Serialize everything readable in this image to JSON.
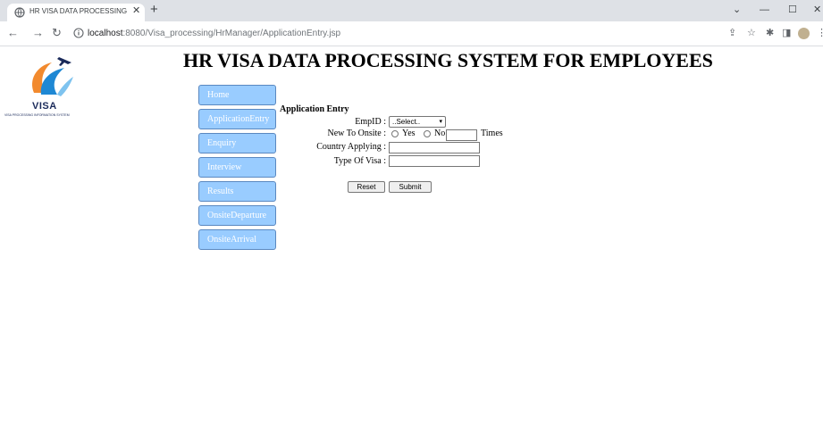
{
  "browser": {
    "tab_title": "HR VISA DATA PROCESSING SYS",
    "url_host": "localhost",
    "url_path": ":8080/Visa_processing/HrManager/ApplicationEntry.jsp"
  },
  "logo": {
    "text": "VISA",
    "subtext": "VISA PROCESSING INFORMATION SYSTEM"
  },
  "page_title": "HR VISA DATA PROCESSING SYSTEM FOR EMPLOYEES",
  "menu": {
    "items": [
      {
        "label": "Home"
      },
      {
        "label": "ApplicationEntry"
      },
      {
        "label": "Enquiry"
      },
      {
        "label": "Interview"
      },
      {
        "label": "Results"
      },
      {
        "label": "OnsiteDeparture"
      },
      {
        "label": "OnsiteArrival"
      }
    ]
  },
  "form": {
    "heading": "Application Entry",
    "empid_label": "EmpID :",
    "empid_selected": "..Select..",
    "new_to_onsite_label": "New To Onsite :",
    "yes_label": "Yes",
    "no_label": "No",
    "times_label": "Times",
    "country_label": "Country Applying :",
    "visa_type_label": "Type Of Visa :",
    "reset_label": "Reset",
    "submit_label": "Submit"
  },
  "colors": {
    "menu_button": "#99ccff",
    "menu_border": "#5a88c0",
    "logo_orange": "#f28a2e",
    "logo_blue": "#1e88d4"
  }
}
